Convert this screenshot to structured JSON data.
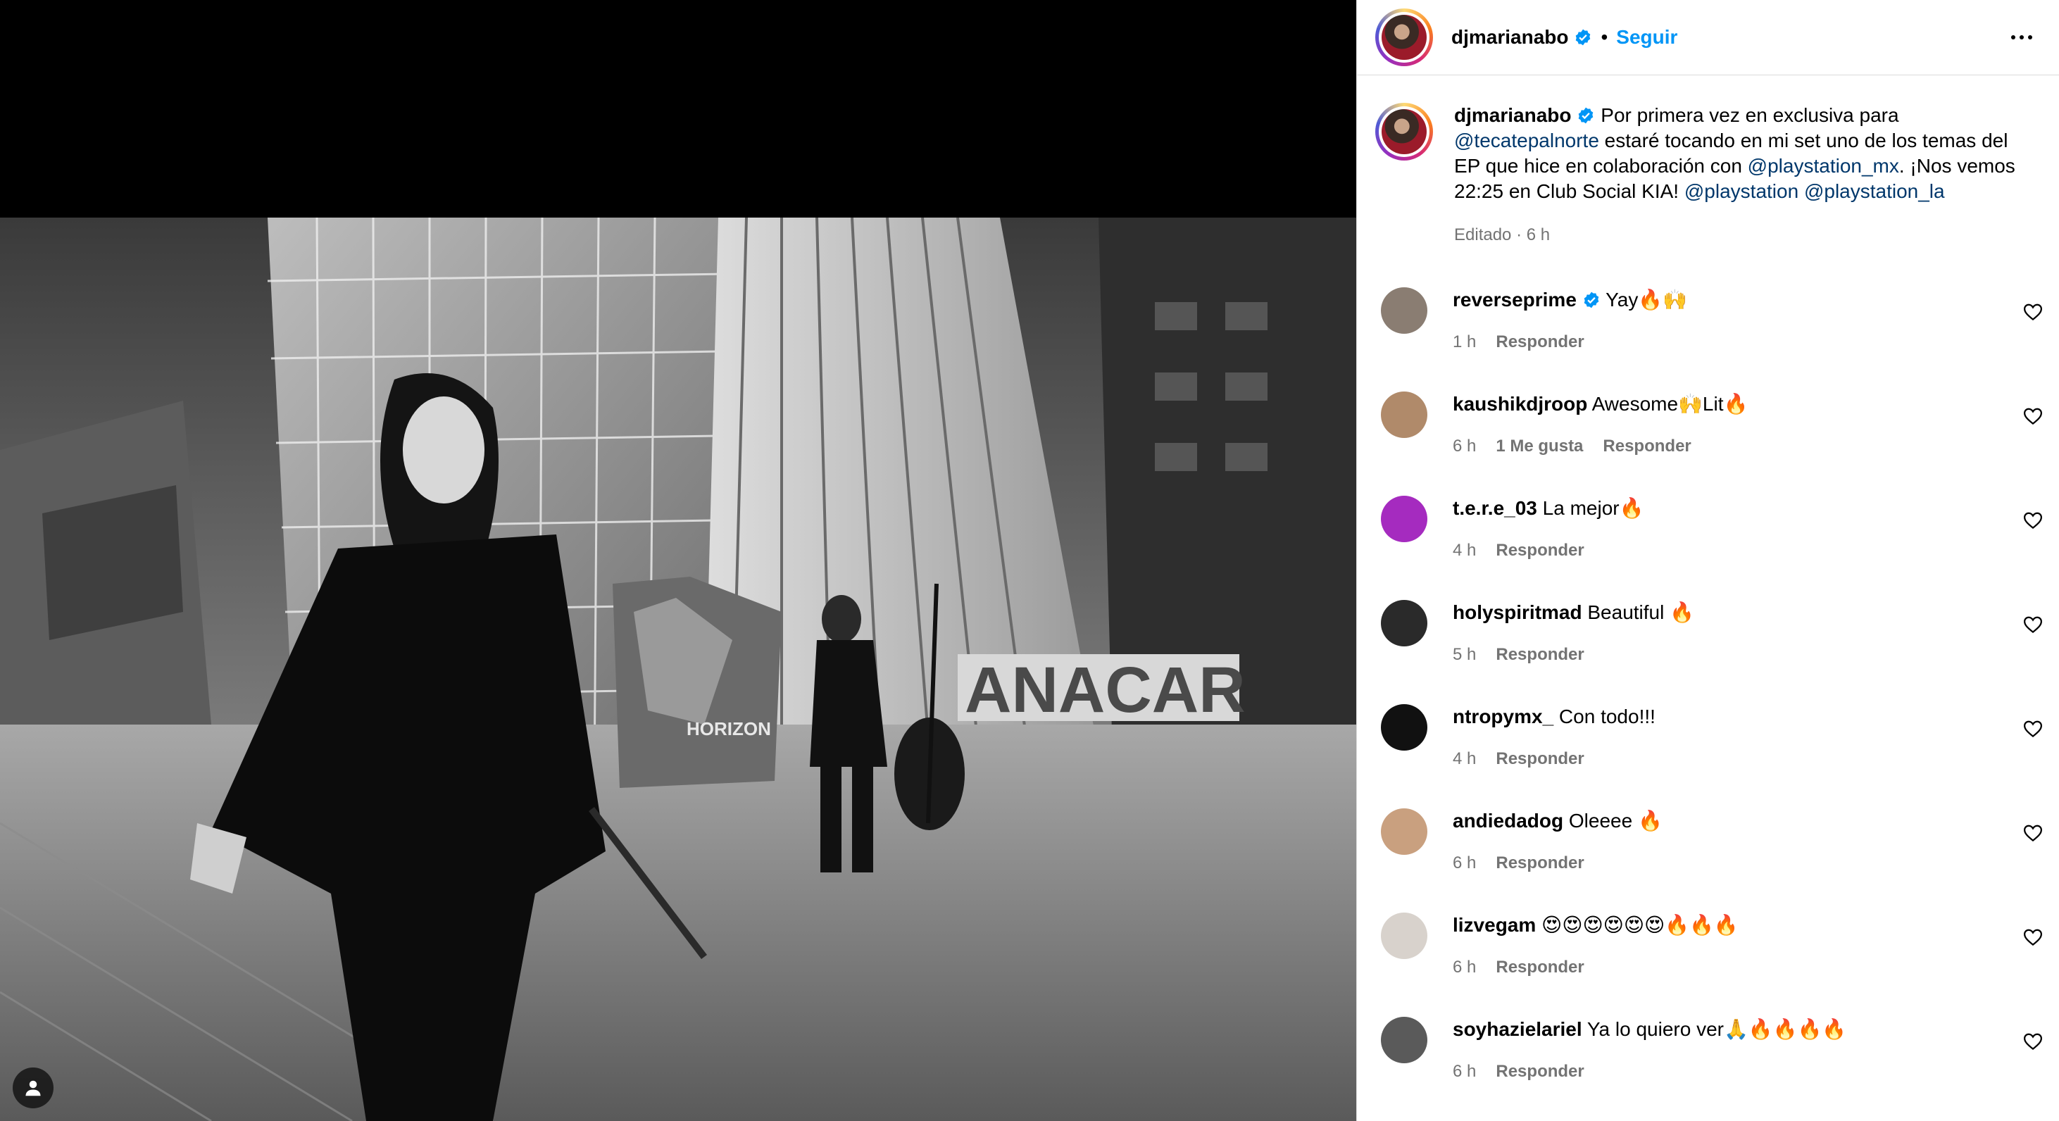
{
  "post": {
    "username": "djmarianabo",
    "follow_label": "Seguir",
    "separator": "•",
    "caption_parts": [
      {
        "text": "Por primera vez en exclusiva para ",
        "mention": false
      },
      {
        "text": "@tecatepalnorte",
        "mention": true
      },
      {
        "text": " estaré tocando en mi set uno de los temas del EP que hice en colaboración con ",
        "mention": false
      },
      {
        "text": "@playstation_mx",
        "mention": true
      },
      {
        "text": ". ¡Nos vemos 22:25 en Club Social KIA! ",
        "mention": false
      },
      {
        "text": "@playstation",
        "mention": true
      },
      {
        "text": " ",
        "mention": false
      },
      {
        "text": "@playstation_la",
        "mention": true
      }
    ],
    "meta": "Editado · 6 h"
  },
  "icons": {
    "verified": "verified-badge-icon",
    "more": "more-options-icon",
    "heart": "heart-icon",
    "tag": "user-tag-icon"
  },
  "colors": {
    "follow": "#0095f6",
    "mention": "#00376b",
    "secondary": "#737373",
    "verified": "#0095f6"
  },
  "reply_label": "Responder",
  "comments": [
    {
      "username": "reverseprime",
      "verified": true,
      "text": "Yay🔥🙌",
      "time": "1 h",
      "likes": "",
      "avatar": "#8a7d72"
    },
    {
      "username": "kaushikdjroop",
      "verified": false,
      "text": "Awesome🙌Lit🔥",
      "time": "6 h",
      "likes": "1 Me gusta",
      "avatar": "#b08a6a"
    },
    {
      "username": "t.e.r.e_03",
      "verified": false,
      "text": "La mejor🔥",
      "time": "4 h",
      "likes": "",
      "avatar": "#a52bbf"
    },
    {
      "username": "holyspiritmad",
      "verified": false,
      "text": "Beautiful 🔥",
      "time": "5 h",
      "likes": "",
      "avatar": "#2a2a2a"
    },
    {
      "username": "ntropymx_",
      "verified": false,
      "text": "Con todo!!!",
      "time": "4 h",
      "likes": "",
      "avatar": "#111111"
    },
    {
      "username": "andiedadog",
      "verified": false,
      "text": "Oleeee 🔥",
      "time": "6 h",
      "likes": "",
      "avatar": "#c9a07f"
    },
    {
      "username": "lizvegam",
      "verified": false,
      "text": "😍😍😍😍😍😍🔥🔥🔥",
      "time": "6 h",
      "likes": "",
      "avatar": "#d8d2cc"
    },
    {
      "username": "soyhazielariel",
      "verified": false,
      "text": "Ya lo quiero ver🙏🔥🔥🔥🔥",
      "time": "6 h",
      "likes": "",
      "avatar": "#5a5a5a"
    }
  ],
  "photo": {
    "sign_text": "ANACAR",
    "statue_text": "HORIZON"
  }
}
